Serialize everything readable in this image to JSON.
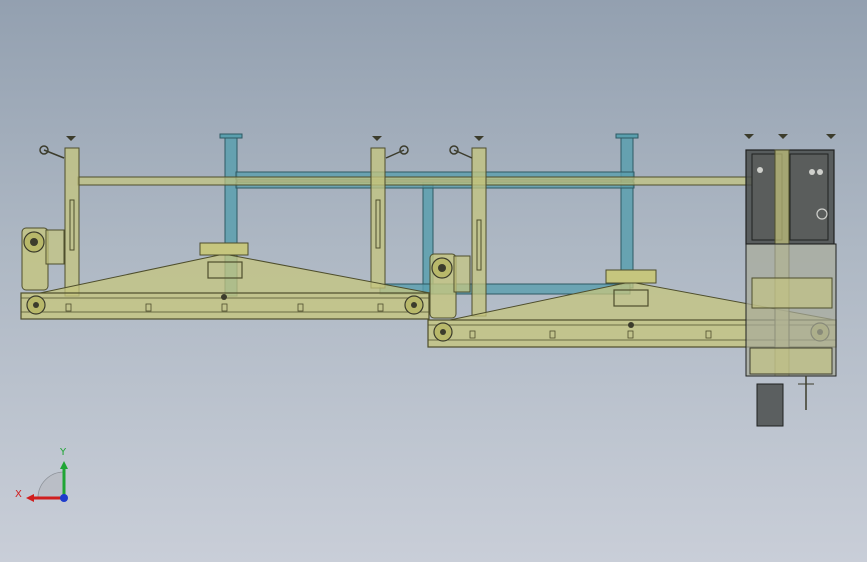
{
  "viewport": {
    "background_top": "#93a0b0",
    "background_bottom": "#c9ced8"
  },
  "colors": {
    "frame_olive": "#b8b86a",
    "frame_olive_fill": "#c6c67e",
    "frame_dark": "#4e4e2c",
    "beam_teal": "#5a9fae",
    "cabinet_dark": "#4a4d4c",
    "axis_x": "#d01e1e",
    "axis_y": "#1fa535",
    "axis_z": "#1e3ccc"
  },
  "triad": {
    "x_label": "X",
    "y_label": "Y"
  }
}
